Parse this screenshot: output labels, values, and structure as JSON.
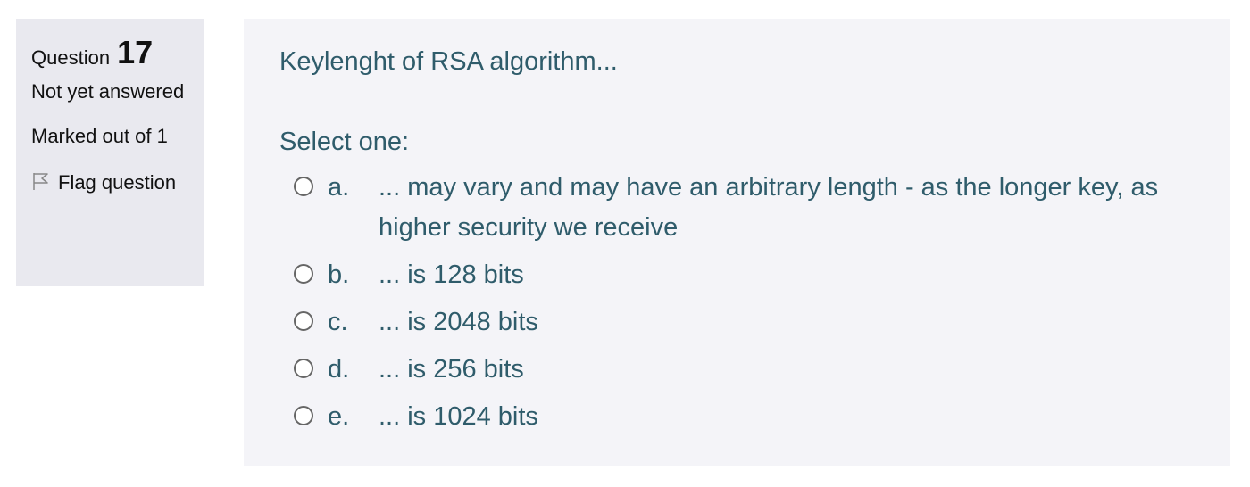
{
  "question_info": {
    "question_label": "Question",
    "question_number": "17",
    "state": "Not yet answered",
    "grade": "Marked out of 1",
    "flag_label": "Flag question"
  },
  "content": {
    "question_text": "Keylenght of RSA algorithm...",
    "prompt": "Select one:",
    "answers": [
      {
        "letter": "a.",
        "text": "... may vary and may have an arbitrary length - as the longer key, as higher security we receive"
      },
      {
        "letter": "b.",
        "text": "... is 128 bits"
      },
      {
        "letter": "c.",
        "text": "... is 2048 bits"
      },
      {
        "letter": "d.",
        "text": "... is 256 bits"
      },
      {
        "letter": "e.",
        "text": "... is 1024 bits"
      }
    ]
  }
}
